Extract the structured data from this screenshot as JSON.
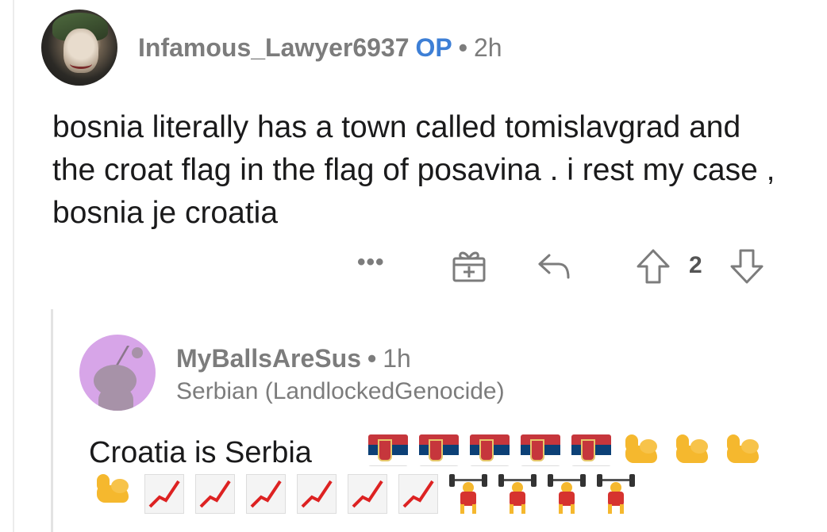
{
  "parent_comment": {
    "username": "Infamous_Lawyer6937",
    "op_badge": "OP",
    "separator": "•",
    "time": "2h",
    "body": "bosnia literally has a town called tomislavgrad and the croat flag in the flag of posavina . i rest my case , bosnia je croatia",
    "actions": {
      "more_label": "•••",
      "score": "2"
    }
  },
  "reply_comment": {
    "username": "MyBallsAreSus",
    "separator": "•",
    "time": "1h",
    "flair": "Serbian (LandlockedGenocide)",
    "body": "Croatia is Serbia",
    "emojis_line1": [
      "serbia-flag",
      "serbia-flag",
      "serbia-flag",
      "serbia-flag",
      "serbia-flag",
      "flexed-biceps",
      "flexed-biceps",
      "flexed-biceps"
    ],
    "emojis_line2": [
      "flexed-biceps",
      "chart-increasing",
      "chart-increasing",
      "chart-increasing",
      "chart-increasing",
      "chart-increasing",
      "chart-increasing",
      "weight-lifter",
      "weight-lifter",
      "weight-lifter",
      "weight-lifter"
    ]
  },
  "colors": {
    "op_badge": "#3d7fd6",
    "meta_text": "#7c7c7c",
    "snoo_avatar_bg": "#d7a5e8"
  }
}
